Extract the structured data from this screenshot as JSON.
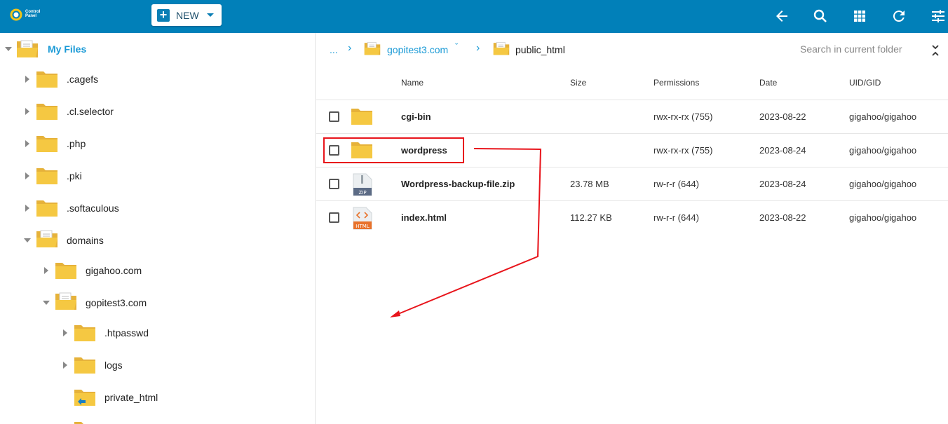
{
  "app": {
    "logo_text": "Control Panel"
  },
  "toolbar": {
    "new_label": "NEW",
    "icons": [
      "back-arrow-icon",
      "search-icon",
      "grid-view-icon",
      "refresh-icon",
      "settings-sliders-icon"
    ]
  },
  "sidebar": {
    "root": "My Files",
    "items": [
      {
        "label": ".cagefs"
      },
      {
        "label": ".cl.selector"
      },
      {
        "label": ".php"
      },
      {
        "label": ".pki"
      },
      {
        "label": ".softaculous"
      },
      {
        "label": "domains"
      },
      {
        "label": "gigahoo.com"
      },
      {
        "label": "gopitest3.com"
      },
      {
        "label": ".htpasswd"
      },
      {
        "label": "logs"
      },
      {
        "label": "private_html"
      }
    ]
  },
  "breadcrumb": {
    "ellipsis": "...",
    "domain": "gopitest3.com",
    "current": "public_html"
  },
  "search": {
    "placeholder": "Search in current folder"
  },
  "table": {
    "headers": {
      "name": "Name",
      "size": "Size",
      "permissions": "Permissions",
      "date": "Date",
      "uid": "UID/GID"
    },
    "rows": [
      {
        "name": "cgi-bin",
        "type": "folder",
        "size": "",
        "permissions": "rwx-rx-rx (755)",
        "date": "2023-08-22",
        "uid": "gigahoo/gigahoo"
      },
      {
        "name": "wordpress",
        "type": "folder",
        "size": "",
        "permissions": "rwx-rx-rx (755)",
        "date": "2023-08-24",
        "uid": "gigahoo/gigahoo"
      },
      {
        "name": "Wordpress-backup-file.zip",
        "type": "zip",
        "size": "23.78 MB",
        "permissions": "rw-r-r (644)",
        "date": "2023-08-24",
        "uid": "gigahoo/gigahoo"
      },
      {
        "name": "index.html",
        "type": "html",
        "size": "112.27 KB",
        "permissions": "rw-r-r (644)",
        "date": "2023-08-22",
        "uid": "gigahoo/gigahoo"
      }
    ],
    "file_badges": {
      "zip": "ZIP",
      "html": "HTML"
    }
  },
  "colors": {
    "topbar": "#0180b9",
    "accent": "#1a9ad6",
    "folder": "#f5c842",
    "annotation": "#e8141b"
  }
}
